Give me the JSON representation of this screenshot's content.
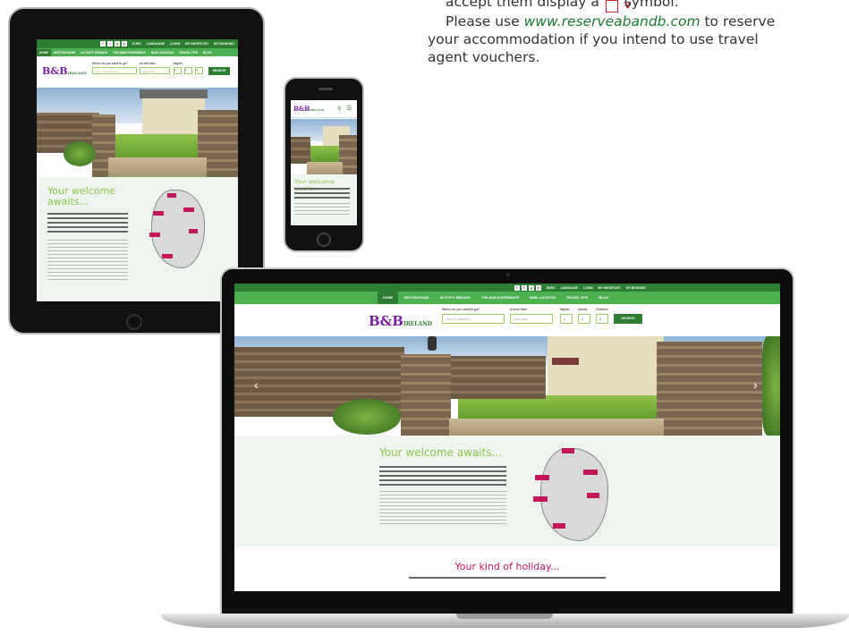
{
  "side_text": {
    "line0_prefix": "accept them display a",
    "line0_symbol": "V",
    "line0_suffix": "symbol.",
    "line1_prefix": "Please use",
    "line1_link": "www.reserveabandb.com",
    "line1_suffix": "to reserve",
    "line2": "your accommodation if you intend to use travel",
    "line3": "agent vouchers."
  },
  "site": {
    "brand": "B&B IRELAND",
    "brand_main": "B&B",
    "brand_sub": "IRELAND",
    "topbar": [
      "EURO",
      "LANGUAGE",
      "LOGIN",
      "MY SHORTLIST",
      "MY BOOKING"
    ],
    "social": [
      "f",
      "t",
      "g",
      "p"
    ],
    "nav": [
      "HOME",
      "DESTINATIONS",
      "ACTIVITY BREAKS",
      "THE B&B EXPERIENCE",
      "B&B LOCATION",
      "TRAVEL TIPS",
      "BLOG"
    ],
    "nav_ipad": [
      "HOME",
      "DESTINATIONS",
      "ACTIVITY BREAKS",
      "THE B&B EXPERIENCE",
      "B&B LOCATION",
      "TRAVEL TIPS",
      "BLOG"
    ],
    "search": {
      "where_label": "Where do you want to go?",
      "where_placeholder": "Town or destination",
      "arrival_label": "Arrival Date",
      "arrival_placeholder": "Select date",
      "nights_label": "Nights",
      "adults_label": "Adults",
      "children_label": "Children",
      "nights_value": "1",
      "adults_value": "2",
      "children_value": "0",
      "button": "SEARCH"
    },
    "welcome_title": "Your welcome awaits...",
    "welcome_title_ipad_1": "Your welcome",
    "welcome_title_ipad_2": "awaits...",
    "welcome_lead": "Consectetur eiusmod tempor incididunt adipiscing eiusmod elit, sed do eiusmod tempor incididunt ut labore et dolore magna aliqua.",
    "welcome_body": "Sed ut perspiciatis unde omnis iste natus error sit voluptatem accusantium doloremque laudantium, totam rem aperiam, eaque ipsa quae ab illo inventore veritatis et quasi architecto beatae vitae dicta sunt explicabo.",
    "holiday_title": "Your kind of holiday...",
    "holiday_sub": "Lorem ipsum dolor sit amet, consectetur adipiscing elit, sed do eiusmod tempor incididunt ut."
  },
  "colors": {
    "brand_green": "#2e7d32",
    "nav_green": "#4caf50",
    "accent_purple": "#c2185b",
    "title_green": "#8bc34a"
  }
}
